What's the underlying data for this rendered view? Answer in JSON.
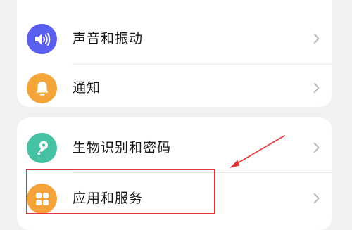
{
  "settings_groups": [
    {
      "items": [
        {
          "label": "声音和振动",
          "icon": "volume-icon",
          "icon_color": "#5b5ff0"
        },
        {
          "label": "通知",
          "icon": "bell-icon",
          "icon_color": "#f3a53a"
        }
      ]
    },
    {
      "items": [
        {
          "label": "生物识别和密码",
          "icon": "key-icon",
          "icon_color": "#45c1a4"
        },
        {
          "label": "应用和服务",
          "icon": "apps-icon",
          "icon_color": "#f4a23a"
        }
      ]
    }
  ],
  "annotation": {
    "highlight_color": "#e23a3a",
    "target": "应用和服务"
  }
}
